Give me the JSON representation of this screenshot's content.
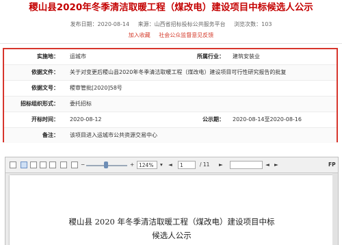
{
  "header": {
    "title": "稷山县2020年冬季清洁取暖工程（煤改电）建设项目中标候选人公示",
    "publish_date": "发布日期：2020-08-14",
    "source": "来源：山西省招标投标公共服务平台",
    "views": "浏览次数：103",
    "action_favorite": "加入收藏",
    "action_feedback": "社会公众监督意见反馈"
  },
  "info": {
    "rows": [
      {
        "label": "实施地：",
        "value": "运城市",
        "label2": "所属行业：",
        "value2": "建筑安装业"
      },
      {
        "label": "依据文件：",
        "value": "关于对变更后稷山县2020年冬季清洁取暖工程（煤改电）建设项目可行性研究报告的批复"
      },
      {
        "label": "依据文号：",
        "value": "稷审管批[2020]58号"
      },
      {
        "label": "招标组织形式：",
        "value": "委托招标"
      },
      {
        "label": "开标时间：",
        "value": "2020-08-12",
        "label2": "公示期：",
        "value2": "2020-08-14至2020-08-16"
      },
      {
        "label": "备注：",
        "value": "该项目进入运城市公共资源交易中心"
      }
    ]
  },
  "viewer": {
    "zoom": "124%",
    "page_current": "1",
    "page_total": "/ 11",
    "search_placeholder": "",
    "fp_label": "FP",
    "doc_title_line1": "稷山县 2020 年冬季清洁取暖工程（煤改电）建设项目中标",
    "doc_title_line2": "候选人公示"
  }
}
